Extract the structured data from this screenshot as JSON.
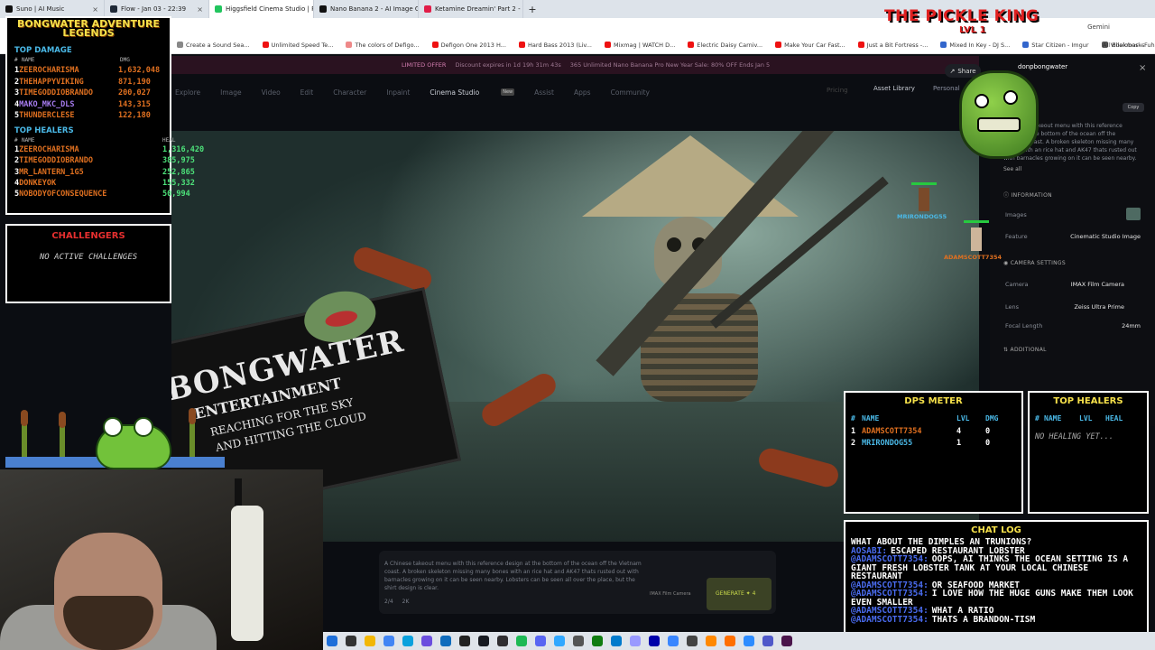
{
  "browser": {
    "tabs": [
      {
        "label": "Suno | AI Music",
        "color": "#111111",
        "active": false
      },
      {
        "label": "Flow - Jan 03 - 22:39",
        "color": "#1f2937",
        "active": false
      },
      {
        "label": "Higgsfield Cinema Studio | Pro",
        "color": "#22c55e",
        "active": true
      },
      {
        "label": "Nano Banana 2 - AI Image Gen",
        "color": "#111111",
        "active": false
      },
      {
        "label": "Ketamine Dreamin' Part 2 - Yo",
        "color": "#e11d48",
        "active": false
      }
    ],
    "new_tab": "+",
    "profile_label": "Gemini",
    "bookmarks": [
      "Create a Sound Sea...",
      "Unlimited Speed Te...",
      "The colors of Defigo...",
      "Defigon One 2013 H...",
      "Hard Bass 2013 (Liv...",
      "Mixmag | WATCH D...",
      "Electric Daisy Carniv...",
      "Make Your Car Fast...",
      "Just a Bit Fortress -...",
      "Mixed In Key - DJ S...",
      "Star Citizen - Imgur",
      "Villalobos - Fuhrun...",
      "Bonobo 50 mix Rol...",
      "Kritz.net"
    ],
    "all_bookmarks": "All Bookmarks"
  },
  "page": {
    "promo_label": "LIMITED OFFER",
    "promo_timer": "Discount expires in 1d 19h 31m 43s",
    "promo_text": "365 Unlimited Nano Banana Pro New Year Sale: 80% OFF Ends Jan 5",
    "nav": [
      "Explore",
      "Image",
      "Video",
      "Edit",
      "Character",
      "Inpaint",
      "Cinema Studio",
      "Assist",
      "Apps",
      "Community"
    ],
    "nav_active": "Cinema Studio",
    "nav_badge": "New",
    "pricing": "Pricing",
    "asset_library": "Asset Library",
    "personal": "Personal",
    "share": "Share",
    "prompt_text": "A Chinese takeout menu with this reference design at the bottom of the ocean off the Vietnam coast. A broken skeleton missing many bones with an rice hat and AK47 thats rusted out with barnacles growing on it can be seen nearby. Lobsters can be seen all over the place, but the shirt design is clear.",
    "prompt_meta_1": "2/4",
    "prompt_meta_2": "2K",
    "prompt_meta_3": "IMAX Film Camera",
    "generate": "GENERATE ✦ 4",
    "sign": {
      "title": "BONGWATER",
      "subtitle": "ENTERTAINMENT",
      "line1": "REACHING FOR THE SKY",
      "line2": "AND HITTING THE CLOUD"
    }
  },
  "panel": {
    "username": "donpbongwater",
    "close": "×",
    "copy": "Copy",
    "description": "A Chinese takeout menu with this reference design at the bottom of the ocean off the Vietnam coast. A broken skeleton missing many bones with an rice hat and AK47 thats rusted out with barnacles growing on it can be seen nearby.",
    "see_all": "See all",
    "information_header": "INFORMATION",
    "info_rows": [
      {
        "label": "Images",
        "value": ""
      },
      {
        "label": "Feature",
        "value": "Cinematic Studio Image"
      }
    ],
    "camera_header": "CAMERA SETTINGS",
    "camera_rows": [
      {
        "label": "Camera",
        "value": "IMAX Film Camera"
      },
      {
        "label": "Lens",
        "value": "Zeiss Ultra Prime"
      },
      {
        "label": "Focal Length",
        "value": "24mm"
      }
    ],
    "additional_header": "ADDITIONAL"
  },
  "overlay": {
    "pickle_king": "THE PICKLE KING",
    "pickle_lvl": "LVL 1",
    "characters": [
      {
        "name": "MRIRONDOG55"
      },
      {
        "name": "ADAMSCOTT7354"
      }
    ],
    "legends_title": "BONGWATER ADVENTURE LEGENDS",
    "top_damage_title": "TOP DAMAGE",
    "top_damage_headers": {
      "num": "#",
      "name": "NAME",
      "value": "DMG"
    },
    "top_damage": [
      {
        "rank": "1",
        "name": "ZEEROCHARISMA",
        "value": "1,632,048",
        "style": "orange"
      },
      {
        "rank": "2",
        "name": "THEHAPPYVIKING",
        "value": "871,190",
        "style": "orange"
      },
      {
        "rank": "3",
        "name": "TIMEGODDIOBRANDO",
        "value": "200,027",
        "style": "orange"
      },
      {
        "rank": "4",
        "name": "MAKO_MKC_DLS",
        "value": "143,315",
        "style": "violet"
      },
      {
        "rank": "5",
        "name": "THUNDERCLESE",
        "value": "122,180",
        "style": "orange"
      }
    ],
    "top_healers_title": "TOP HEALERS",
    "top_healers_headers": {
      "num": "#",
      "name": "NAME",
      "value": "HEAL"
    },
    "top_healers": [
      {
        "rank": "1",
        "name": "ZEEROCHARISMA",
        "value": "1,316,420",
        "style": "orange"
      },
      {
        "rank": "2",
        "name": "TIMEGODDIOBRANDO",
        "value": "385,975",
        "style": "orange"
      },
      {
        "rank": "3",
        "name": "MR_LANTERN_1G5",
        "value": "252,865",
        "style": "orange"
      },
      {
        "rank": "4",
        "name": "DONKEYOK",
        "value": "155,332",
        "style": "orange"
      },
      {
        "rank": "5",
        "name": "NOBODYOFCONSEQUENCE",
        "value": "50,994",
        "style": "orange"
      }
    ],
    "challengers_title": "CHALLENGERS",
    "challengers_text": "NO ACTIVE CHALLENGES",
    "dps_title": "DPS METER",
    "dps_headers": {
      "num": "#",
      "name": "NAME",
      "lvl": "LVL",
      "dmg": "DMG"
    },
    "dps_rows": [
      {
        "rank": "1",
        "name": "ADAMSCOTT7354",
        "lvl": "4",
        "dmg": "0"
      },
      {
        "rank": "2",
        "name": "MRIRONDOG55",
        "lvl": "1",
        "dmg": "0"
      }
    ],
    "healers_box_title": "TOP HEALERS",
    "healers_box_headers": {
      "num": "#",
      "name": "NAME",
      "lvl": "LVL",
      "heal": "HEAL"
    },
    "healers_box_text": "NO HEALING YET...",
    "chat_title": "CHAT LOG",
    "chat": [
      {
        "user": "",
        "text": "WHAT ABOUT THE DIMPLES AN TRUNIONS?"
      },
      {
        "user": "AOSABI:",
        "text": "ESCAPED RESTAURANT LOBSTER"
      },
      {
        "user": "@ADAMSCOTT7354:",
        "text": "OOPS, AI THINKS THE OCEAN SETTING IS A GIANT FRESH LOBSTER TANK AT YOUR LOCAL CHINESE RESTAURANT"
      },
      {
        "user": "@ADAMSCOTT7354:",
        "text": "OR SEAFOOD MARKET"
      },
      {
        "user": "@ADAMSCOTT7354:",
        "text": "I LOVE HOW THE HUGE GUNS MAKE THEM LOOK EVEN SMALLER"
      },
      {
        "user": "@ADAMSCOTT7354:",
        "text": "WHAT A RATIO"
      },
      {
        "user": "@ADAMSCOTT7354:",
        "text": "THATS A BRANDON-TISM"
      }
    ]
  },
  "taskbar_icons": [
    "windows-icon",
    "search-icon",
    "file-explorer-icon",
    "chrome-icon",
    "edge-icon",
    "store-icon",
    "mail-icon",
    "terminal-icon",
    "steam-icon",
    "obs-icon",
    "spotify-icon",
    "discord-icon",
    "photoshop-icon",
    "settings-icon",
    "xbox-icon",
    "vs-code-icon",
    "premiere-icon",
    "audacity-icon",
    "notepad-icon",
    "calculator-icon",
    "paint-icon",
    "vlc-icon",
    "zoom-icon",
    "teams-icon",
    "slack-icon"
  ]
}
